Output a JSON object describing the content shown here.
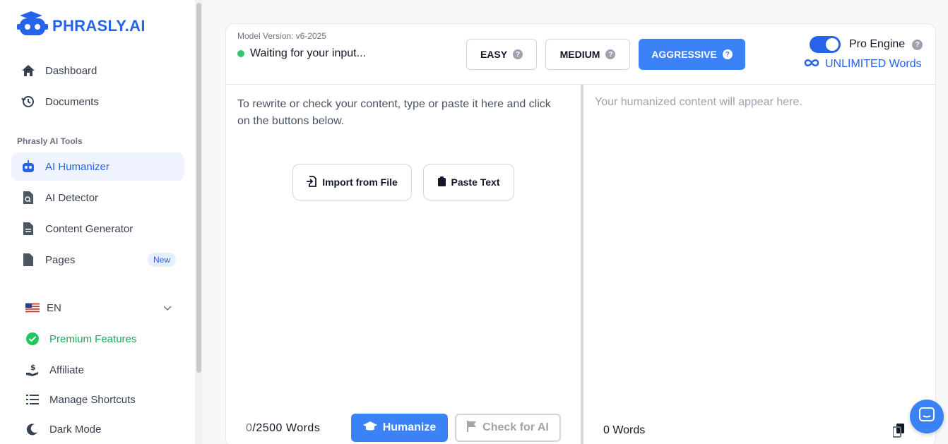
{
  "brand": {
    "name": "PHRASLY.AI",
    "accent": "#2563eb"
  },
  "nav": {
    "dashboard": "Dashboard",
    "documents": "Documents",
    "tools_label": "Phrasly AI Tools",
    "humanizer": "AI Humanizer",
    "detector": "AI Detector",
    "generator": "Content Generator",
    "pages": "Pages",
    "pages_badge": "New",
    "language": "EN",
    "premium": "Premium Features",
    "affiliate": "Affiliate",
    "shortcuts": "Manage Shortcuts",
    "dark_mode": "Dark Mode"
  },
  "editor": {
    "model_version": "Model Version: v6-2025",
    "status": "Waiting for your input...",
    "modes": {
      "easy": "EASY",
      "medium": "MEDIUM",
      "aggressive": "AGGRESSIVE",
      "selected": "AGGRESSIVE"
    },
    "pro_engine": "Pro Engine",
    "pro_engine_on": true,
    "unlimited": "UNLIMITED Words",
    "input_placeholder": "To rewrite or check your content, type or paste it here and click on the buttons below.",
    "output_placeholder": "Your humanized content will appear here.",
    "import_label": "Import from File",
    "paste_label": "Paste Text",
    "word_count_current": "0",
    "word_count_limit": "/2500 Words",
    "humanize_label": "Humanize",
    "check_label": "Check for AI",
    "output_words": "0 Words"
  }
}
